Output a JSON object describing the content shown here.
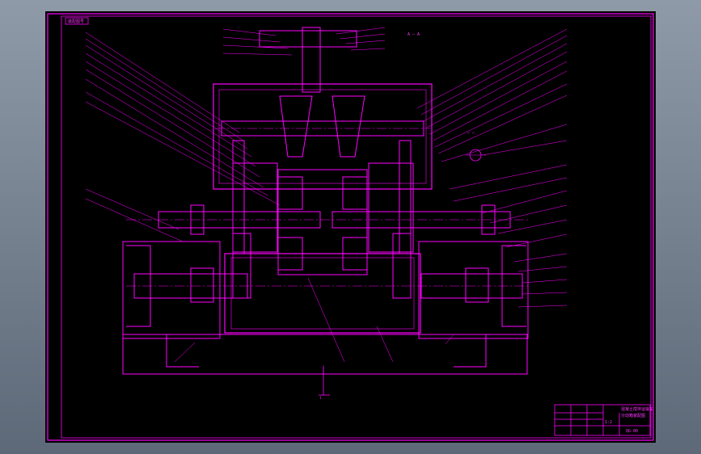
{
  "drawing": {
    "corner_tag": "装配图号",
    "section_mark": "A — A",
    "section_label": "Ⅰ",
    "callout_dash": "— —",
    "colors": {
      "background": "#000000",
      "line": "#ff00ff",
      "frame": "#ff33ff"
    },
    "title_block": {
      "title_line1": "混凝土搅拌运输车",
      "title_line2": "分动箱装配图",
      "drawing_number": "QG-00",
      "scale": "1:2"
    }
  }
}
